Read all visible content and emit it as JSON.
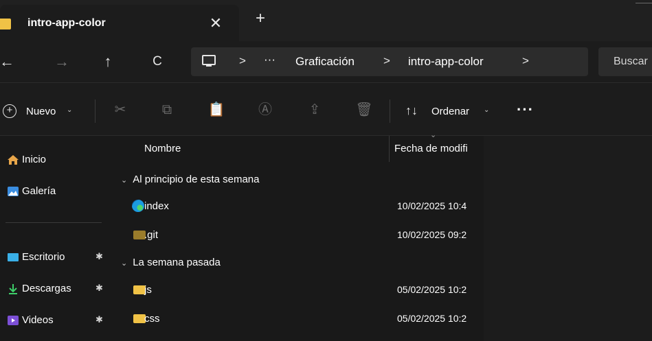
{
  "tab": {
    "title": "intro-app-color",
    "close_glyph": "✕",
    "new_glyph": "+"
  },
  "nav": {
    "back": "←",
    "forward": "→",
    "up": "↑",
    "refresh": "C"
  },
  "address": {
    "sep": ">",
    "overflow": "···",
    "crumbs": [
      "Graficación",
      "intro-app-color"
    ],
    "search_text": "Buscar"
  },
  "commands": {
    "new_label": "Nuevo",
    "new_icon": "plus-circle-icon",
    "chevron": "⌄",
    "sort_label": "Ordenar",
    "sort_icon": "↑↓",
    "more": "···",
    "icons": [
      "cut-icon",
      "copy-icon",
      "paste-icon",
      "rename-icon",
      "share-icon",
      "delete-icon"
    ]
  },
  "sidebar": {
    "items": [
      {
        "label": "Inicio",
        "icon": "home-icon"
      },
      {
        "label": "Galería",
        "icon": "gallery-icon"
      },
      {
        "label": "Escritorio",
        "icon": "desktop-icon",
        "pinned": true
      },
      {
        "label": "Descargas",
        "icon": "download-icon",
        "pinned": true
      },
      {
        "label": "Videos",
        "icon": "video-icon",
        "pinned": true
      }
    ],
    "pin_glyph": "📌"
  },
  "list": {
    "columns": [
      "Nombre",
      "Fecha de modifi"
    ],
    "groups": [
      {
        "label": "Al principio de esta semana",
        "files": [
          {
            "name": "index",
            "date": "10/02/2025 10:4",
            "icon": "edge-icon"
          },
          {
            "name": ".git",
            "date": "10/02/2025 09:2",
            "icon": "folder-icon"
          }
        ]
      },
      {
        "label": "La semana pasada",
        "files": [
          {
            "name": "js",
            "date": "05/02/2025 10:2",
            "icon": "folder-icon"
          },
          {
            "name": "css",
            "date": "05/02/2025 10:2",
            "icon": "folder-icon"
          }
        ]
      }
    ]
  },
  "colors": {
    "background": "#191919",
    "folder": "#f0c246",
    "accent_blue": "#3a8de0"
  }
}
